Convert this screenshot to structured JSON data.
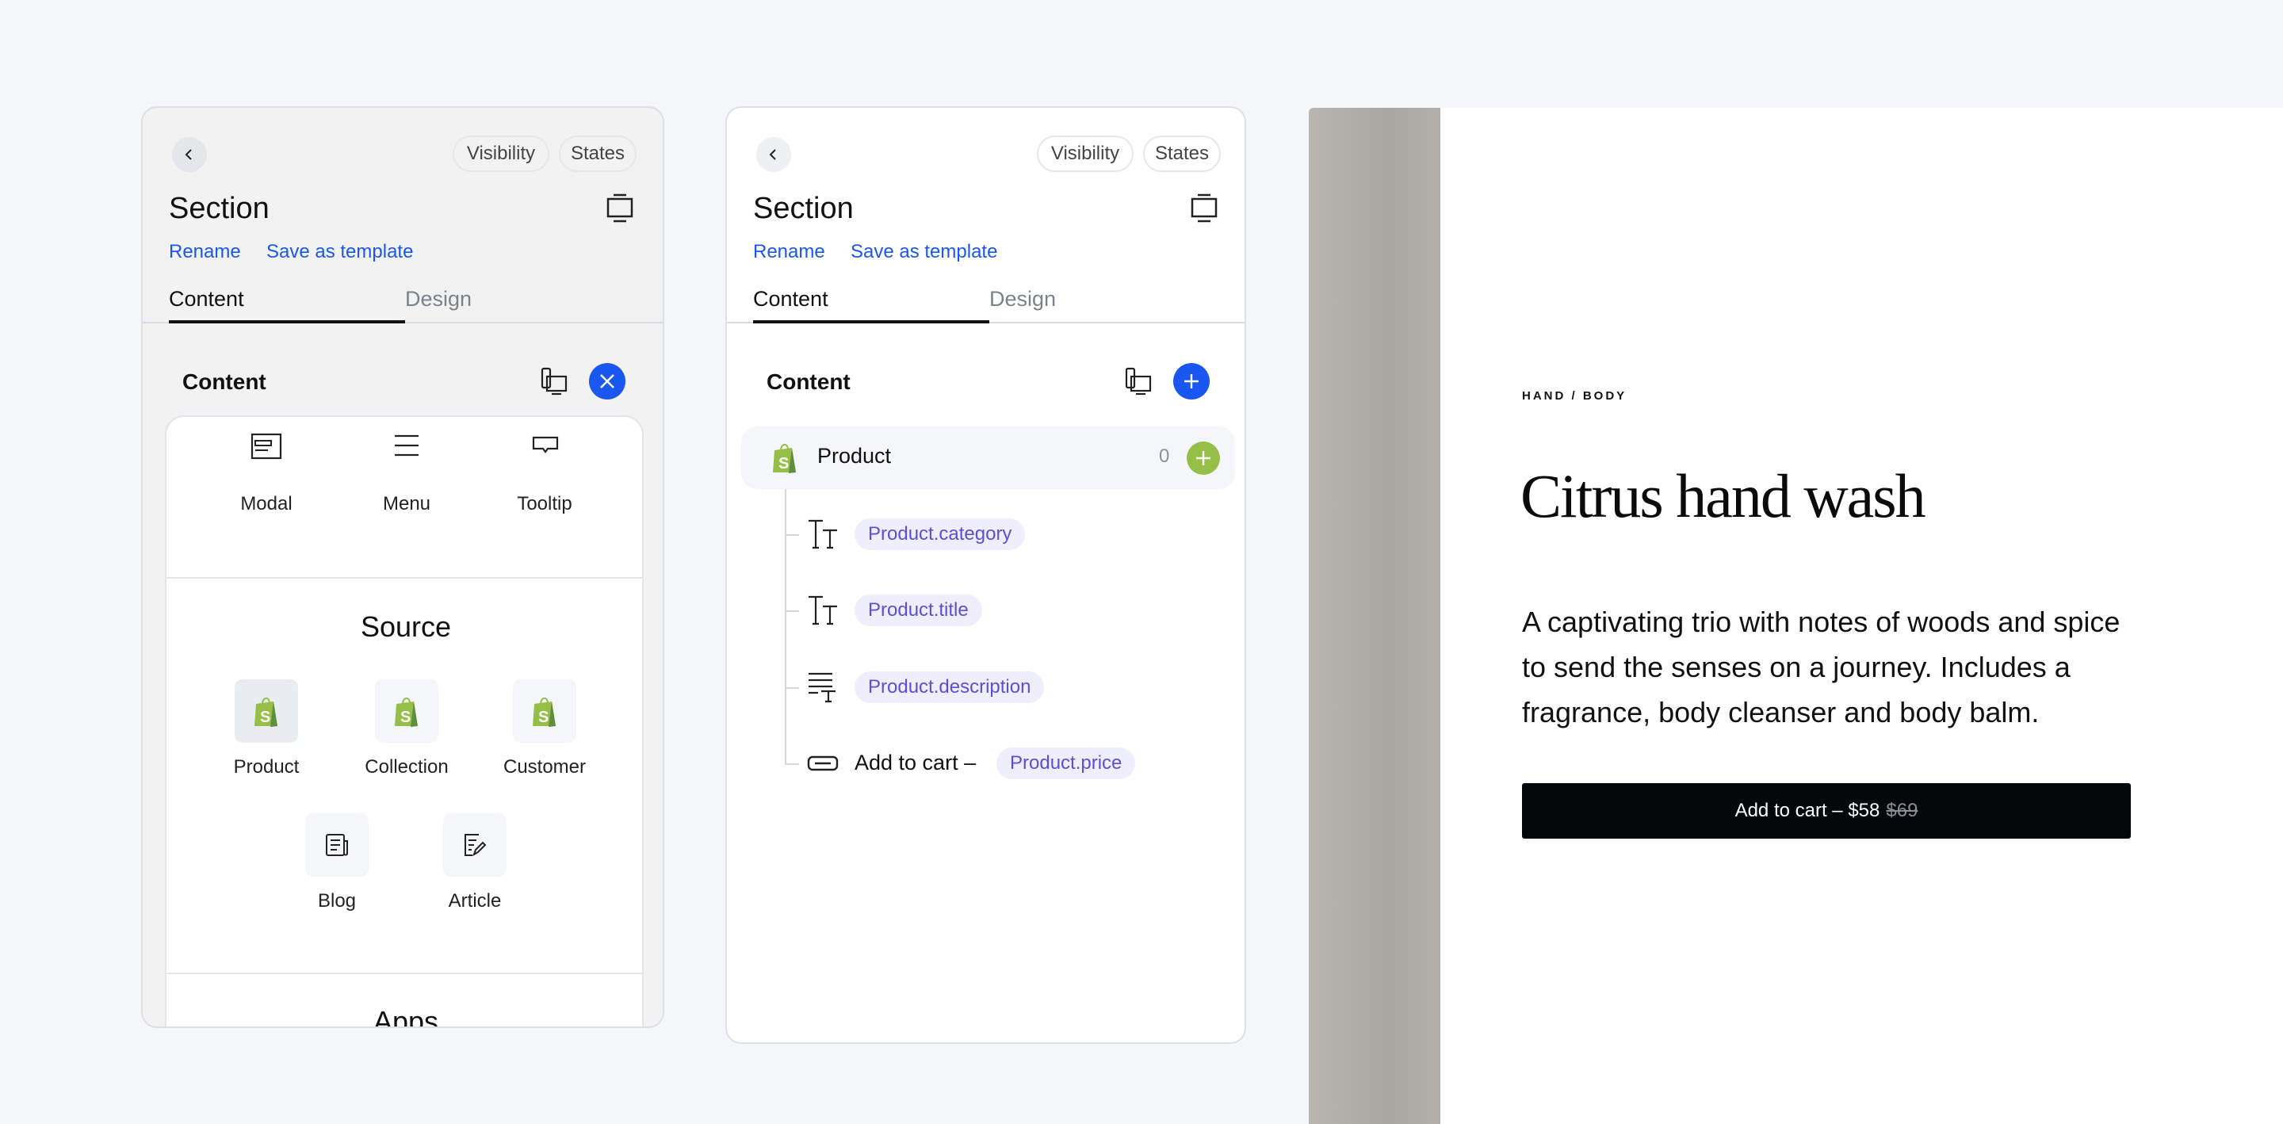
{
  "panel_common": {
    "visibility": "Visibility",
    "states": "States",
    "title": "Section",
    "rename": "Rename",
    "save_template": "Save as template",
    "tabs": [
      "Content",
      "Design"
    ],
    "content_heading": "Content"
  },
  "picker": {
    "layout_items": [
      "Modal",
      "Menu",
      "Tooltip"
    ],
    "source_heading": "Source",
    "source_items": [
      "Product",
      "Collection",
      "Customer",
      "Blog",
      "Article"
    ],
    "apps_heading": "Apps"
  },
  "tree": {
    "root_label": "Product",
    "root_count": "0",
    "children": [
      {
        "icon": "text-icon",
        "chip": "Product.category"
      },
      {
        "icon": "text-icon",
        "chip": "Product.title"
      },
      {
        "icon": "paragraph-icon",
        "chip": "Product.description"
      },
      {
        "icon": "button-icon",
        "prefix": "Add to cart –",
        "chip": "Product.price"
      }
    ]
  },
  "preview": {
    "breadcrumb": "HAND / BODY",
    "title": "Citrus hand wash",
    "description": "A captivating trio with notes of woods and spice to send the senses on a journey. Includes a fragrance, body cleanser and body balm.",
    "button_label": "Add to cart – $58",
    "compare_price": "$69"
  },
  "colors": {
    "accent": "#1a56f0",
    "shopify_green": "#95bf47",
    "chip_text": "#5b4fd6",
    "button_bg": "#05080b"
  }
}
